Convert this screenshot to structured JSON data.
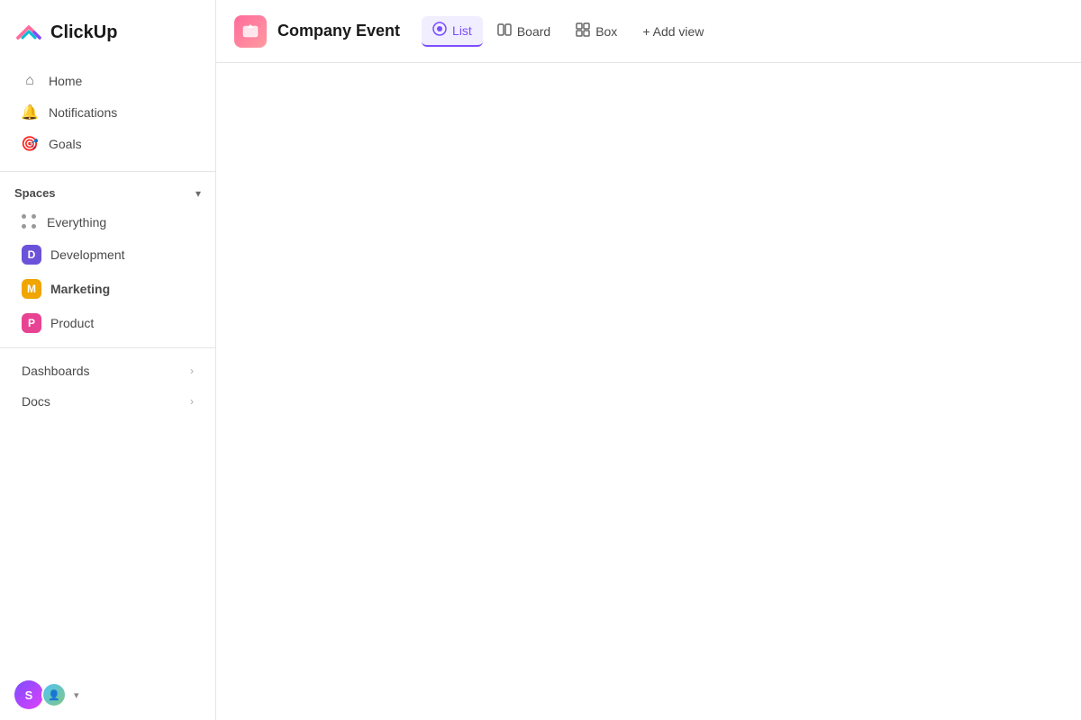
{
  "logo": {
    "text": "ClickUp"
  },
  "nav": {
    "home_label": "Home",
    "notifications_label": "Notifications",
    "goals_label": "Goals"
  },
  "spaces": {
    "section_label": "Spaces",
    "items": [
      {
        "id": "everything",
        "label": "Everything",
        "type": "dots"
      },
      {
        "id": "development",
        "label": "Development",
        "type": "avatar",
        "avatar_letter": "D",
        "avatar_class": "dev"
      },
      {
        "id": "marketing",
        "label": "Marketing",
        "type": "avatar",
        "avatar_letter": "M",
        "avatar_class": "mkt",
        "bold": true
      },
      {
        "id": "product",
        "label": "Product",
        "type": "avatar",
        "avatar_letter": "P",
        "avatar_class": "prd"
      }
    ]
  },
  "sections": [
    {
      "id": "dashboards",
      "label": "Dashboards"
    },
    {
      "id": "docs",
      "label": "Docs"
    }
  ],
  "user": {
    "avatar_letter": "S",
    "dropdown_label": "▾"
  },
  "header": {
    "workspace_name": "Company Event",
    "views": [
      {
        "id": "list",
        "label": "List",
        "active": true
      },
      {
        "id": "board",
        "label": "Board",
        "active": false
      },
      {
        "id": "box",
        "label": "Box",
        "active": false
      }
    ],
    "add_view_label": "+ Add view"
  }
}
